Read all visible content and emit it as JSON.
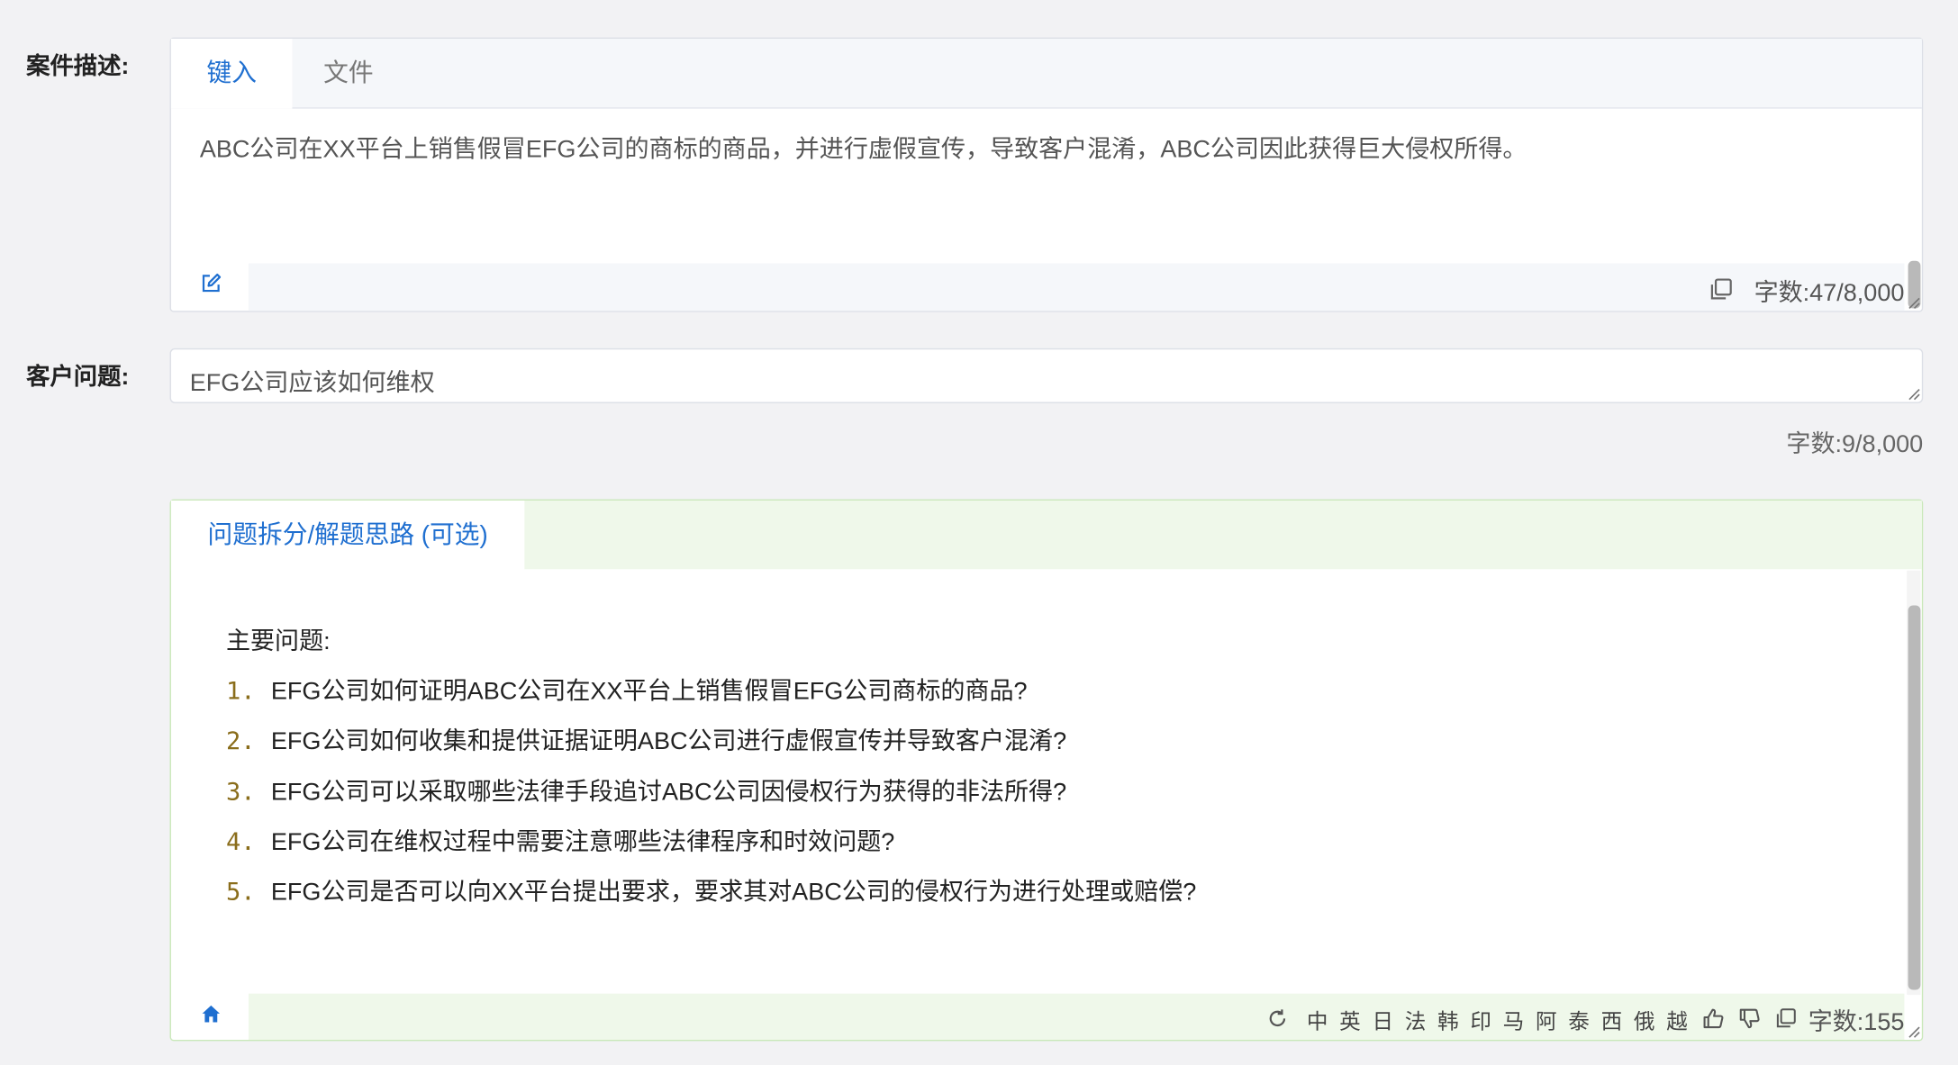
{
  "case": {
    "label": "案件描述:",
    "tabs": [
      "键入",
      "文件"
    ],
    "text": "ABC公司在XX平台上销售假冒EFG公司的商标的商品，并进行虚假宣传，导致客户混淆，ABC公司因此获得巨大侵权所得。",
    "count": "字数:47/8,000"
  },
  "question": {
    "label": "客户问题:",
    "value": "EFG公司应该如何维权",
    "count": "字数:9/8,000"
  },
  "breakdown": {
    "tab": "问题拆分/解题思路 (可选)",
    "heading": "主要问题:",
    "items": [
      {
        "num": "1.",
        "text": "EFG公司如何证明ABC公司在XX平台上销售假冒EFG公司商标的商品?"
      },
      {
        "num": "2.",
        "text": "EFG公司如何收集和提供证据证明ABC公司进行虚假宣传并导致客户混淆?"
      },
      {
        "num": "3.",
        "text": "EFG公司可以采取哪些法律手段追讨ABC公司因侵权行为获得的非法所得?"
      },
      {
        "num": "4.",
        "text": "EFG公司在维权过程中需要注意哪些法律程序和时效问题?"
      },
      {
        "num": "5.",
        "text": "EFG公司是否可以向XX平台提出要求，要求其对ABC公司的侵权行为进行处理或赔偿?"
      }
    ],
    "languages": [
      "中",
      "英",
      "日",
      "法",
      "韩",
      "印",
      "马",
      "阿",
      "泰",
      "西",
      "俄",
      "越"
    ],
    "count": "字数:155"
  },
  "icons": {
    "edit": "edit-icon",
    "copy": "copy-icon",
    "refresh": "refresh-icon",
    "home": "home-icon",
    "like": "thumbs-up-icon",
    "dislike": "thumbs-down-icon"
  },
  "colors": {
    "accent": "#1f6fd0",
    "green_tint": "#eff8ea",
    "green_border": "#c9e8b9",
    "list_number": "#8a6d1b"
  }
}
